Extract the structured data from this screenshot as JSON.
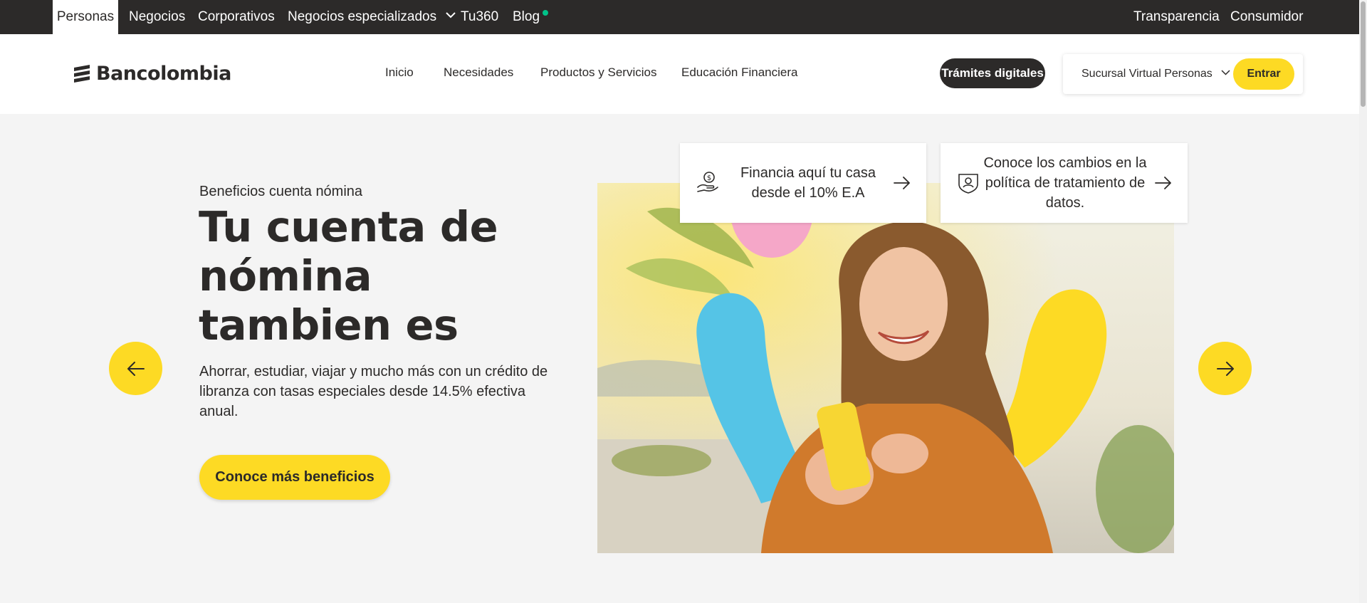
{
  "topbar": {
    "segments": [
      "Personas",
      "Negocios",
      "Corporativos",
      "Negocios especializados",
      "Tu360",
      "Blog"
    ],
    "right_links": [
      "Transparencia",
      "Consumidor"
    ]
  },
  "header": {
    "logo_text": "Bancolombia",
    "nav": [
      "Inicio",
      "Necesidades",
      "Productos y Servicios",
      "Educación Financiera"
    ],
    "tramites_label": "Trámites digitales",
    "sucursal_label": "Sucursal Virtual Personas",
    "entrar_label": "Entrar"
  },
  "hero": {
    "eyebrow": "Beneficios cuenta nómina",
    "title": "Tu cuenta de nómina tambien es",
    "description": "Ahorrar, estudiar, viajar y mucho más con un crédito de libranza con tasas especiales desde 14.5% efectiva anual.",
    "cta_label": "Conoce más beneficios"
  },
  "cards": [
    {
      "text": "Financia aquí tu casa desde el 10% E.A",
      "icon": "money-hand-icon"
    },
    {
      "text": "Conoce los cambios en la política de tratamiento de datos.",
      "icon": "data-policy-icon"
    }
  ],
  "colors": {
    "brand_yellow": "#fdda24",
    "dark": "#2c2a29",
    "background": "#f4f4f4",
    "accent_green": "#00c389"
  }
}
